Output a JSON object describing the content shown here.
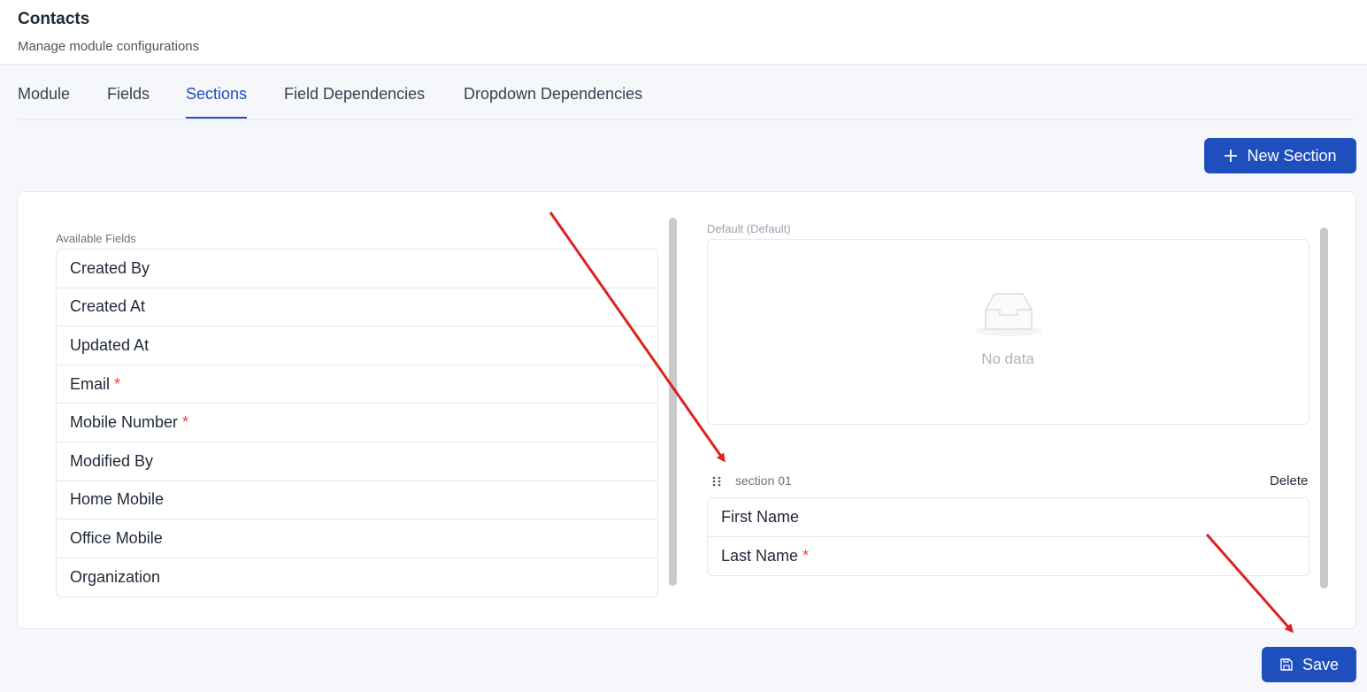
{
  "header": {
    "title": "Contacts",
    "subtitle": "Manage module configurations"
  },
  "tabs": [
    {
      "label": "Module",
      "active": false
    },
    {
      "label": "Fields",
      "active": false
    },
    {
      "label": "Sections",
      "active": true
    },
    {
      "label": "Field Dependencies",
      "active": false
    },
    {
      "label": "Dropdown Dependencies",
      "active": false
    }
  ],
  "toolbar": {
    "new_section_label": "New Section",
    "new_section_icon": "plus-icon"
  },
  "available_fields": {
    "label": "Available Fields",
    "items": [
      {
        "name": "Created By",
        "required": ""
      },
      {
        "name": "Created At",
        "required": ""
      },
      {
        "name": "Updated At",
        "required": ""
      },
      {
        "name": "Email",
        "required": "*"
      },
      {
        "name": "Mobile Number",
        "required": "*"
      },
      {
        "name": "Modified By",
        "required": ""
      },
      {
        "name": "Home Mobile",
        "required": ""
      },
      {
        "name": "Office Mobile",
        "required": ""
      },
      {
        "name": "Organization",
        "required": ""
      }
    ]
  },
  "default_section": {
    "label": "Default (Default)",
    "empty_text": "No data",
    "empty_icon": "inbox-icon"
  },
  "section_01": {
    "name": "section 01",
    "delete_label": "Delete",
    "handle_icon": "drag-handle-icon",
    "fields": [
      {
        "name": "First Name",
        "required": ""
      },
      {
        "name": "Last Name",
        "required": "*"
      }
    ]
  },
  "footer": {
    "save_label": "Save",
    "save_icon": "save-icon"
  },
  "colors": {
    "primary": "#1e4fbd",
    "required": "#ef4444",
    "annotation_arrow": "#e0201d"
  }
}
